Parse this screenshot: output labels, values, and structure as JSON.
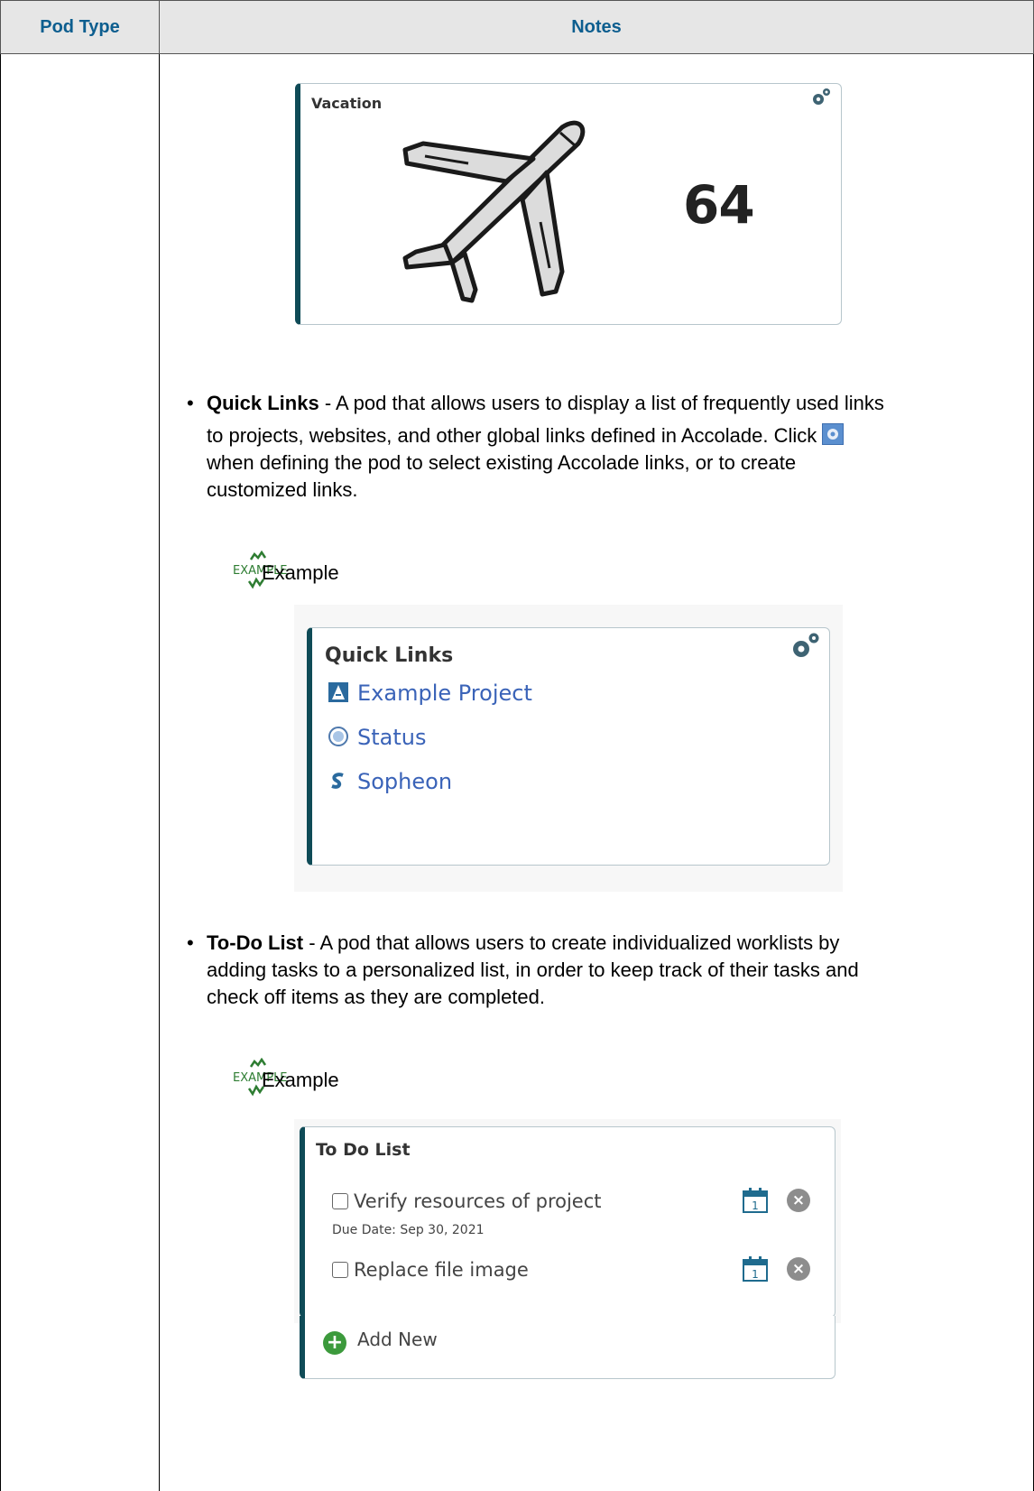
{
  "header": {
    "pod_type": "Pod Type",
    "notes": "Notes"
  },
  "vacation_pod": {
    "title": "Vacation",
    "value": "64"
  },
  "quick_links_bullet": {
    "term": "Quick Links",
    "text_line1": " - A pod that allows users to display a list of frequently used links",
    "text_line2": "to projects, websites, and other global links defined in Accolade. Click ",
    "text_line3": "when defining the pod to select existing Accolade links, or to create",
    "text_line4": "customized links."
  },
  "example_label": "Example",
  "example_icon_text": "EXAMPLE",
  "quick_links_pod": {
    "title": "Quick Links",
    "items": [
      {
        "label": "Example Project",
        "icon": "accolade-icon"
      },
      {
        "label": "Status",
        "icon": "globe-icon"
      },
      {
        "label": "Sopheon",
        "icon": "sopheon-icon"
      }
    ]
  },
  "todo_bullet": {
    "term": "To-Do List",
    "text_line1": " - A pod that allows users to create individualized worklists by",
    "text_line2": "adding tasks to a personalized list, in order to keep track of their tasks and",
    "text_line3": "check off items as they are completed."
  },
  "todo_pod": {
    "title": "To Do List",
    "tasks": [
      {
        "label": "Verify resources of project",
        "due": "Due Date: Sep 30, 2021"
      },
      {
        "label": "Replace file image",
        "due": ""
      }
    ],
    "add_new": "Add New",
    "calendar_day": "1"
  }
}
